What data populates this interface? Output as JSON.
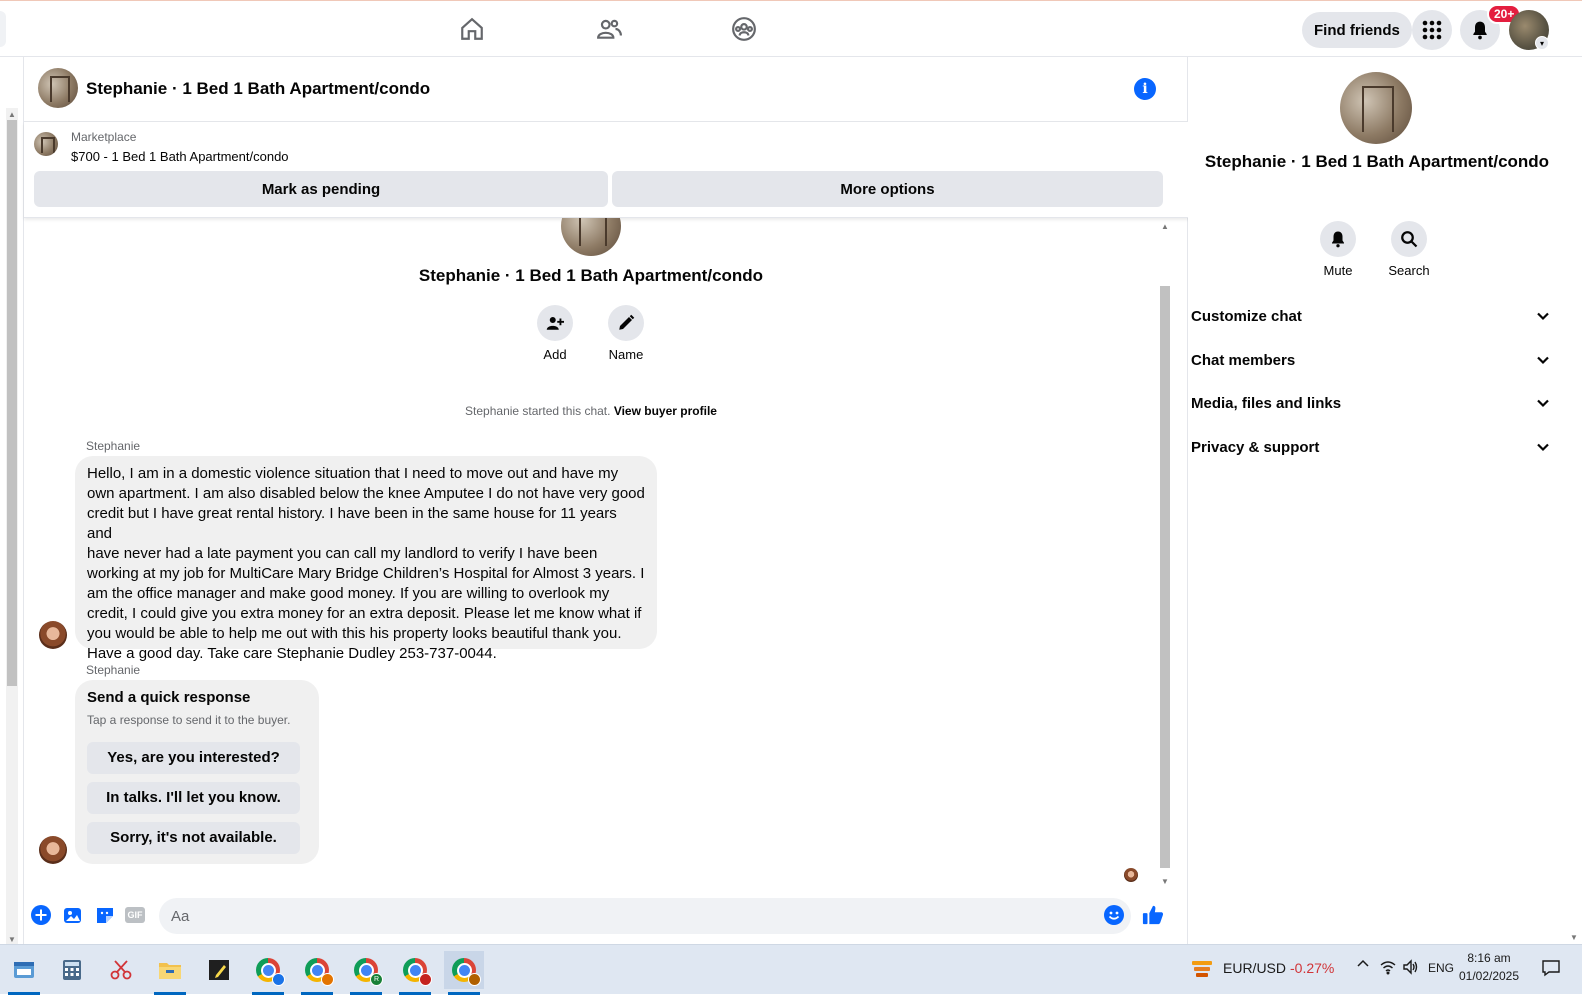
{
  "topbar": {
    "find_friends": "Find friends",
    "notification_badge": "20+",
    "icons": [
      "home-icon",
      "friends-icon",
      "groups-icon",
      "menu-grid-icon",
      "bell-icon"
    ]
  },
  "chat": {
    "title": "Stephanie · 1 Bed 1 Bath Apartment/condo",
    "marketplace_label": "Marketplace",
    "listing": "$700 - 1 Bed 1 Bath Apartment/condo",
    "mark_pending": "Mark as pending",
    "more_options": "More options",
    "intro_title": "Stephanie · 1 Bed 1 Bath Apartment/condo",
    "actions": [
      {
        "label": "Add",
        "icon": "add-person-icon"
      },
      {
        "label": "Name",
        "icon": "pencil-icon"
      }
    ],
    "started_text": "Stephanie started this chat.",
    "view_buyer_profile": "View buyer profile",
    "messages": [
      {
        "sender": "Stephanie",
        "lines": [
          "Hello, I am in a domestic violence situation that I need to move out and have my",
          "own apartment. I am also disabled below the knee Amputee I do not have very good",
          "credit but I have great rental history. I have been in the same house for 11 years and",
          "have never had a late payment you can call my landlord to verify I have been",
          "working at my job for MultiCare Mary Bridge Children’s Hospital for Almost 3 years. I",
          "am the office manager and make good money. If you are willing to overlook my",
          "credit, I could give you extra money for an extra deposit. Please let me know what if",
          "you would be able to help me out with this his property looks beautiful thank you.",
          "Have a good day. Take care Stephanie Dudley 253-737-0044."
        ]
      },
      {
        "sender": "Stephanie",
        "quick_title": "Send a quick response",
        "quick_subtitle": "Tap a response to send it to the buyer.",
        "quick_options": [
          "Yes, are you interested?",
          "In talks. I'll let you know.",
          "Sorry, it's not available."
        ]
      }
    ],
    "composer_placeholder": "Aa",
    "composer_icons": [
      "plus-icon",
      "photo-icon",
      "sticker-icon",
      "gif-icon",
      "emoji-icon",
      "like-icon"
    ],
    "gif_label": "GIF"
  },
  "right_panel": {
    "name": "Stephanie · 1 Bed 1 Bath Apartment/condo",
    "actions": [
      {
        "label": "Mute",
        "icon": "bell-icon"
      },
      {
        "label": "Search",
        "icon": "search-icon"
      }
    ],
    "sections": [
      "Customize chat",
      "Chat members",
      "Media, files and links",
      "Privacy & support"
    ]
  },
  "taskbar": {
    "currency_pair": "EUR/USD",
    "currency_change": "-0.27%",
    "language": "ENG",
    "time": "8:16 am",
    "date": "01/02/2025",
    "chrome_badge": "R",
    "colors": {
      "accent": "#0866ff",
      "negative": "#d13438"
    }
  }
}
